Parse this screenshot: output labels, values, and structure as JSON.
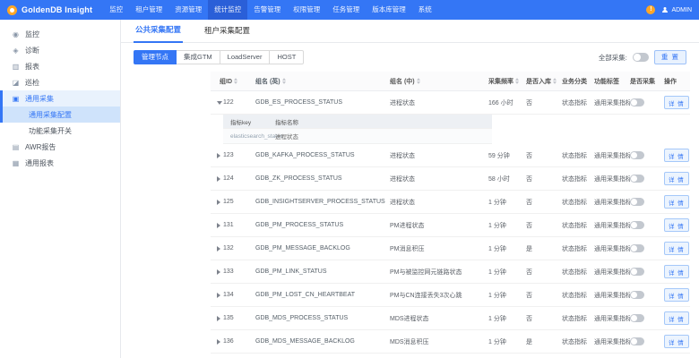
{
  "app": {
    "title": "GoldenDB Insight",
    "user_label": "ADMIN"
  },
  "icons": {
    "notification_glyph": "!"
  },
  "colors": {
    "accent": "#3476f5",
    "topbar": "#3476f5",
    "warning": "#ffa726"
  },
  "topnav": {
    "items": [
      {
        "label": "监控",
        "active": false
      },
      {
        "label": "租户管理",
        "active": false
      },
      {
        "label": "资源管理",
        "active": false
      },
      {
        "label": "统计监控",
        "active": true
      },
      {
        "label": "告警管理",
        "active": false
      },
      {
        "label": "权限管理",
        "active": false
      },
      {
        "label": "任务管理",
        "active": false
      },
      {
        "label": "版本库管理",
        "active": false
      },
      {
        "label": "系统",
        "active": false
      }
    ]
  },
  "sidebar": {
    "items": [
      {
        "label": "监控",
        "icon": "monitor-icon",
        "glyph": "◉"
      },
      {
        "label": "诊断",
        "icon": "diagnosis-icon",
        "glyph": "◈"
      },
      {
        "label": "报表",
        "icon": "report-icon",
        "glyph": "▥"
      },
      {
        "label": "巡检",
        "icon": "inspection-icon",
        "glyph": "◪"
      },
      {
        "label": "通用采集",
        "icon": "collection-icon",
        "glyph": "▣",
        "expanded": true,
        "highlight": true,
        "children": [
          {
            "label": "通用采集配置",
            "selected": true
          },
          {
            "label": "功能采集开关",
            "selected": false
          }
        ]
      },
      {
        "label": "AWR报告",
        "icon": "awr-report-icon",
        "glyph": "▤"
      },
      {
        "label": "通用报表",
        "icon": "general-report-icon",
        "glyph": "▦"
      }
    ]
  },
  "main": {
    "tabs": [
      {
        "label": "公共采集配置",
        "active": true
      },
      {
        "label": "租户采集配置",
        "active": false
      }
    ],
    "filters": [
      {
        "label": "管理节点",
        "active": true
      },
      {
        "label": "集成GTM",
        "active": false
      },
      {
        "label": "LoadServer",
        "active": false
      },
      {
        "label": "HOST",
        "active": false
      }
    ],
    "toolbar": {
      "collect_all_label": "全部采集:",
      "collect_all_on": false,
      "reset_button": "重 置"
    },
    "table": {
      "headers": [
        {
          "label": "组ID",
          "sortable": true
        },
        {
          "label": "组名 (英)",
          "sortable": true
        },
        {
          "label": "组名 (中)",
          "sortable": true
        },
        {
          "label": "采集频率",
          "sortable": true
        },
        {
          "label": "是否入库",
          "sortable": true
        },
        {
          "label": "业务分类",
          "sortable": false
        },
        {
          "label": "功能标签",
          "sortable": false
        },
        {
          "label": "是否采集",
          "sortable": false
        },
        {
          "label": "操作",
          "sortable": false
        }
      ],
      "detail_button": "详 情",
      "rows": [
        {
          "id": "122",
          "name_en": "GDB_ES_PROCESS_STATUS",
          "name_cn": "进程状态",
          "freq": "166 小时",
          "store": "否",
          "category": "状态指标",
          "tag": "通用采集指标",
          "collect_on": false,
          "expanded": true
        },
        {
          "id": "123",
          "name_en": "GDB_KAFKA_PROCESS_STATUS",
          "name_cn": "进程状态",
          "freq": "59 分钟",
          "store": "否",
          "category": "状态指标",
          "tag": "通用采集指标",
          "collect_on": false,
          "expanded": false
        },
        {
          "id": "124",
          "name_en": "GDB_ZK_PROCESS_STATUS",
          "name_cn": "进程状态",
          "freq": "58 小时",
          "store": "否",
          "category": "状态指标",
          "tag": "通用采集指标",
          "collect_on": false,
          "expanded": false
        },
        {
          "id": "125",
          "name_en": "GDB_INSIGHTSERVER_PROCESS_STATUS",
          "name_cn": "进程状态",
          "freq": "1 分钟",
          "store": "否",
          "category": "状态指标",
          "tag": "通用采集指标",
          "collect_on": false,
          "expanded": false
        },
        {
          "id": "131",
          "name_en": "GDB_PM_PROCESS_STATUS",
          "name_cn": "PM进程状态",
          "freq": "1 分钟",
          "store": "否",
          "category": "状态指标",
          "tag": "通用采集指标",
          "collect_on": false,
          "expanded": false
        },
        {
          "id": "132",
          "name_en": "GDB_PM_MESSAGE_BACKLOG",
          "name_cn": "PM消息积压",
          "freq": "1 分钟",
          "store": "是",
          "category": "状态指标",
          "tag": "通用采集指标",
          "collect_on": false,
          "expanded": false
        },
        {
          "id": "133",
          "name_en": "GDB_PM_LINK_STATUS",
          "name_cn": "PM与被监控网元链路状态",
          "freq": "1 分钟",
          "store": "否",
          "category": "状态指标",
          "tag": "通用采集指标",
          "collect_on": false,
          "expanded": false
        },
        {
          "id": "134",
          "name_en": "GDB_PM_LOST_CN_HEARTBEAT",
          "name_cn": "PM与CN连接丢失3次心跳",
          "freq": "1 分钟",
          "store": "否",
          "category": "状态指标",
          "tag": "通用采集指标",
          "collect_on": false,
          "expanded": false
        },
        {
          "id": "135",
          "name_en": "GDB_MDS_PROCESS_STATUS",
          "name_cn": "MDS进程状态",
          "freq": "1 分钟",
          "store": "否",
          "category": "状态指标",
          "tag": "通用采集指标",
          "collect_on": false,
          "expanded": false
        },
        {
          "id": "136",
          "name_en": "GDB_MDS_MESSAGE_BACKLOG",
          "name_cn": "MDS消息积压",
          "freq": "1 分钟",
          "store": "是",
          "category": "状态指标",
          "tag": "通用采集指标",
          "collect_on": false,
          "expanded": false
        }
      ],
      "expanded_detail": {
        "headers": [
          "指标key",
          "指标名称"
        ],
        "rows": [
          {
            "key": "elasticsearch_status",
            "name": "进程状态"
          }
        ]
      }
    }
  }
}
